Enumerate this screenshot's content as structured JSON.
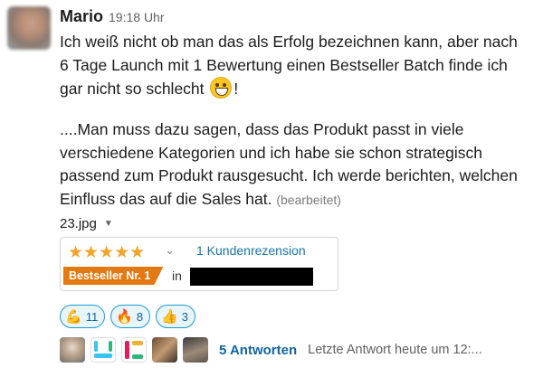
{
  "message": {
    "author": "Mario",
    "time": "19:18 Uhr",
    "paragraph1": "Ich weiß nicht ob man das als Erfolg bezeichnen kann, aber nach 6 Tage Launch mit 1 Bewertung einen Bestseller Batch finde ich gar nicht so schlecht",
    "paragraph1_end": "!",
    "paragraph1_emoji": "grinning-face-emoji",
    "paragraph2": "....Man muss dazu sagen, dass das Produkt passt in viele verschiedene Kategorien und ich habe sie schon strategisch passend zum Produkt rausgesucht. Ich werde berichten, welchen Einfluss das auf die Sales hat.",
    "edited_label": "(bearbeitet)"
  },
  "attachment": {
    "filename": "23.jpg",
    "stars": "★★★★★",
    "rating_stars": 5,
    "reviews_link": "1 Kundenrezension",
    "badge": "Bestseller Nr. 1",
    "in_label": "in"
  },
  "reactions": [
    {
      "icon": "flexed-biceps-emoji",
      "glyph": "💪",
      "count": "11"
    },
    {
      "icon": "fire-emoji",
      "glyph": "🔥",
      "count": "8"
    },
    {
      "icon": "thumbs-up-emoji",
      "glyph": "👍",
      "count": "3"
    }
  ],
  "thread": {
    "replies": "5 Antworten",
    "last_reply": "Letzte Antwort heute um 12:..."
  },
  "colors": {
    "link": "#1264a3",
    "reaction_border": "#1d9bd1",
    "badge": "#e47911",
    "stars": "#f0a42b"
  }
}
